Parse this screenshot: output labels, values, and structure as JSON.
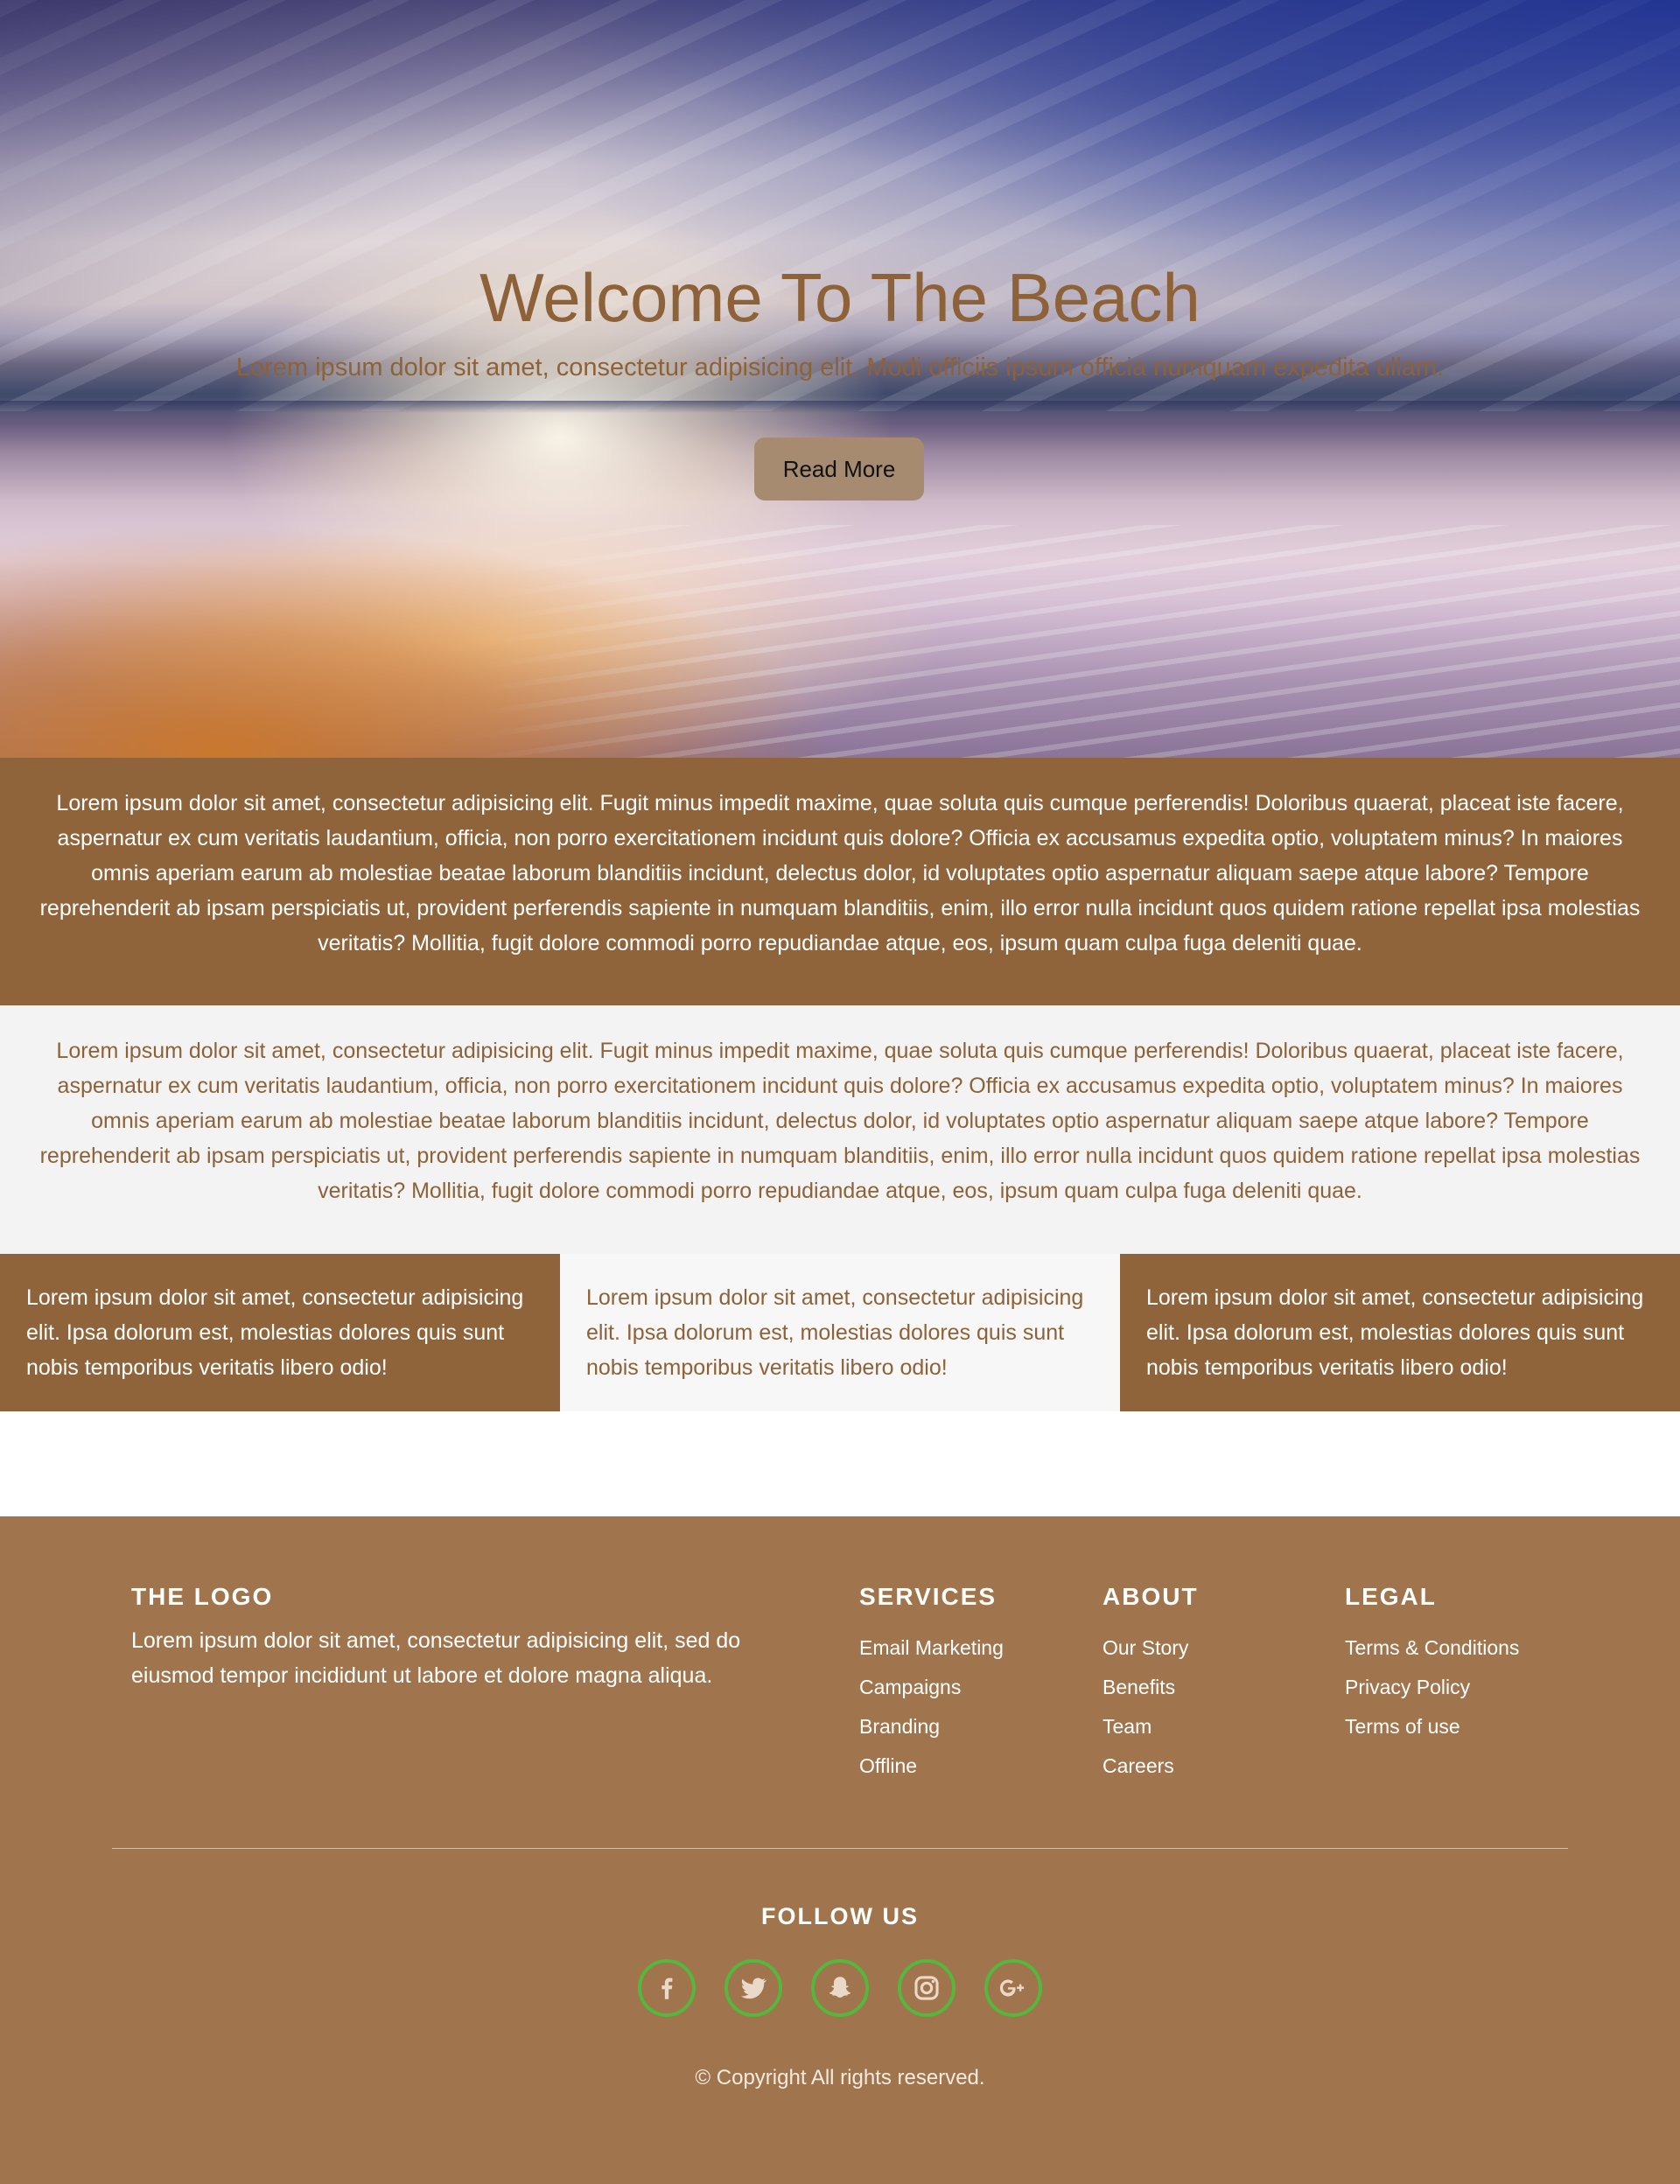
{
  "hero": {
    "title": "Welcome To The Beach",
    "subtitle": "Lorem ipsum dolor sit amet, consectetur adipisicing elit. Modi officiis ipsum officia numquam expedita ullam.",
    "button_label": "Read More"
  },
  "section_brown": {
    "text": "Lorem ipsum dolor sit amet, consectetur adipisicing elit. Fugit minus impedit maxime, quae soluta quis cumque perferendis! Doloribus quaerat, placeat iste facere, aspernatur ex cum veritatis laudantium, officia, non porro exercitationem incidunt quis dolore? Officia ex accusamus expedita optio, voluptatem minus? In maiores omnis aperiam earum ab molestiae beatae laborum blanditiis incidunt, delectus dolor, id voluptates optio aspernatur aliquam saepe atque labore? Tempore reprehenderit ab ipsam perspiciatis ut, provident perferendis sapiente in numquam blanditiis, enim, illo error nulla incidunt quos quidem ratione repellat ipsa molestias veritatis? Mollitia, fugit dolore commodi porro repudiandae atque, eos, ipsum quam culpa fuga deleniti quae."
  },
  "section_light": {
    "text": "Lorem ipsum dolor sit amet, consectetur adipisicing elit. Fugit minus impedit maxime, quae soluta quis cumque perferendis! Doloribus quaerat, placeat iste facere, aspernatur ex cum veritatis laudantium, officia, non porro exercitationem incidunt quis dolore? Officia ex accusamus expedita optio, voluptatem minus? In maiores omnis aperiam earum ab molestiae beatae laborum blanditiis incidunt, delectus dolor, id voluptates optio aspernatur aliquam saepe atque labore? Tempore reprehenderit ab ipsam perspiciatis ut, provident perferendis sapiente in numquam blanditiis, enim, illo error nulla incidunt quos quidem ratione repellat ipsa molestias veritatis? Mollitia, fugit dolore commodi porro repudiandae atque, eos, ipsum quam culpa fuga deleniti quae."
  },
  "columns": [
    {
      "text": "Lorem ipsum dolor sit amet, consectetur adipisicing elit. Ipsa dolorum est, molestias dolores quis sunt nobis temporibus veritatis libero odio!"
    },
    {
      "text": "Lorem ipsum dolor sit amet, consectetur adipisicing elit. Ipsa dolorum est, molestias dolores quis sunt nobis temporibus veritatis libero odio!"
    },
    {
      "text": "Lorem ipsum dolor sit amet, consectetur adipisicing elit. Ipsa dolorum est, molestias dolores quis sunt nobis temporibus veritatis libero odio!"
    }
  ],
  "footer": {
    "logo": "THE LOGO",
    "logo_text": "Lorem ipsum dolor sit amet, consectetur adipisicing elit, sed do eiusmod tempor incididunt ut labore et dolore magna aliqua.",
    "services": {
      "heading": "SERVICES",
      "items": [
        "Email Marketing",
        "Campaigns",
        "Branding",
        "Offline"
      ]
    },
    "about": {
      "heading": "ABOUT",
      "items": [
        "Our Story",
        "Benefits",
        "Team",
        "Careers"
      ]
    },
    "legal": {
      "heading": "LEGAL",
      "items": [
        "Terms & Conditions",
        "Privacy Policy",
        "Terms of use"
      ]
    },
    "follow_heading": "FOLLOW US",
    "socials": [
      "facebook-icon",
      "twitter-icon",
      "snapchat-icon",
      "instagram-icon",
      "google-plus-icon"
    ],
    "copyright": "© Copyright All rights reserved."
  },
  "colors": {
    "brown": "#8f643b",
    "footer_brown": "#a0744c",
    "hero_text": "#8e6238",
    "social_ring": "#54b83c"
  }
}
